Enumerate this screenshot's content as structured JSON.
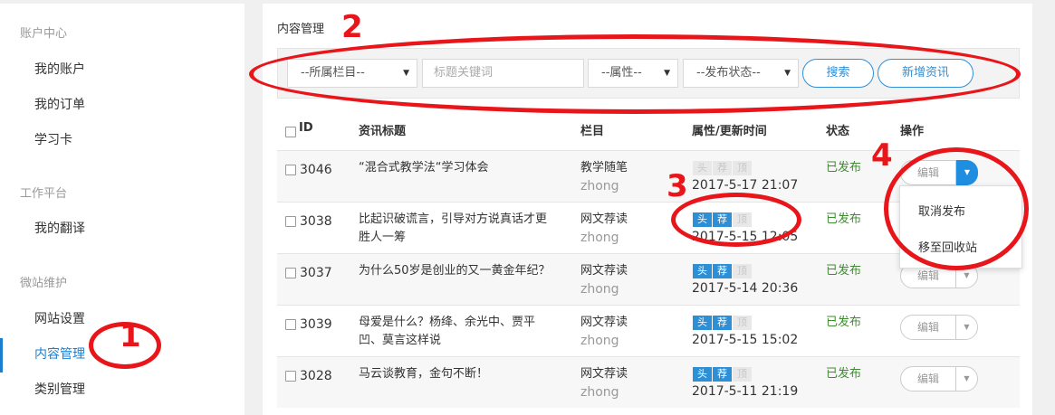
{
  "sidebar": {
    "groups": [
      "账户中心",
      "工作平台",
      "微站维护"
    ],
    "items": {
      "account": "我的账户",
      "orders": "我的订单",
      "card": "学习卡",
      "translation": "我的翻译",
      "site_settings": "网站设置",
      "content": "内容管理",
      "category": "类别管理"
    },
    "active_item": "内容管理"
  },
  "page": {
    "title": "内容管理"
  },
  "filters": {
    "column_select": "--所属栏目--",
    "keyword_placeholder": "标题关键词",
    "attribute_select": "--属性--",
    "status_select": "--发布状态--",
    "search_button": "搜索",
    "add_button": "新增资讯"
  },
  "table": {
    "headers": [
      "ID",
      "资讯标题",
      "栏目",
      "属性/更新时间",
      "状态",
      "操作"
    ],
    "rows": [
      {
        "id": "3046",
        "title_l1": "“混合式教学法“学习体会",
        "title_l2": "",
        "column": "教学随笔",
        "author": "zhong",
        "tags": [
          "头",
          "荐",
          "顶"
        ],
        "tags_on": [
          false,
          false,
          false
        ],
        "time": "2017-5-17 21:07",
        "status": "已发布"
      },
      {
        "id": "3038",
        "title_l1": "比起识破谎言，引导对方说真话才更",
        "title_l2": "胜人一筹",
        "column": "网文荐读",
        "author": "zhong",
        "tags": [
          "头",
          "荐",
          "顶"
        ],
        "tags_on": [
          true,
          true,
          false
        ],
        "time": "2017-5-15 12:05",
        "status": "已发布"
      },
      {
        "id": "3037",
        "title_l1": "为什么50岁是创业的又一黄金年纪？",
        "title_l2": "",
        "column": "网文荐读",
        "author": "zhong",
        "tags": [
          "头",
          "荐",
          "顶"
        ],
        "tags_on": [
          true,
          true,
          false
        ],
        "time": "2017-5-14 20:36",
        "status": "已发布"
      },
      {
        "id": "3039",
        "title_l1": "母爱是什么？杨绛、余光中、贾平",
        "title_l2": "凹、莫言这样说",
        "column": "网文荐读",
        "author": "zhong",
        "tags": [
          "头",
          "荐",
          "顶"
        ],
        "tags_on": [
          true,
          true,
          false
        ],
        "time": "2017-5-15 15:02",
        "status": "已发布"
      },
      {
        "id": "3028",
        "title_l1": "马云谈教育，金句不断！",
        "title_l2": "",
        "column": "网文荐读",
        "author": "zhong",
        "tags": [
          "头",
          "荐",
          "顶"
        ],
        "tags_on": [
          true,
          true,
          false
        ],
        "time": "2017-5-11 21:19",
        "status": "已发布"
      }
    ],
    "edit_label": "编辑"
  },
  "dropdown_menu": {
    "items": [
      "取消发布",
      "移至回收站"
    ]
  },
  "annotations": {
    "labels": [
      "1",
      "2",
      "3",
      "4"
    ],
    "color": "#e8151a"
  },
  "colors": {
    "accent": "#1a7fd0",
    "status_published": "#3d8c2e",
    "tag_on": "#2d8fd6"
  }
}
